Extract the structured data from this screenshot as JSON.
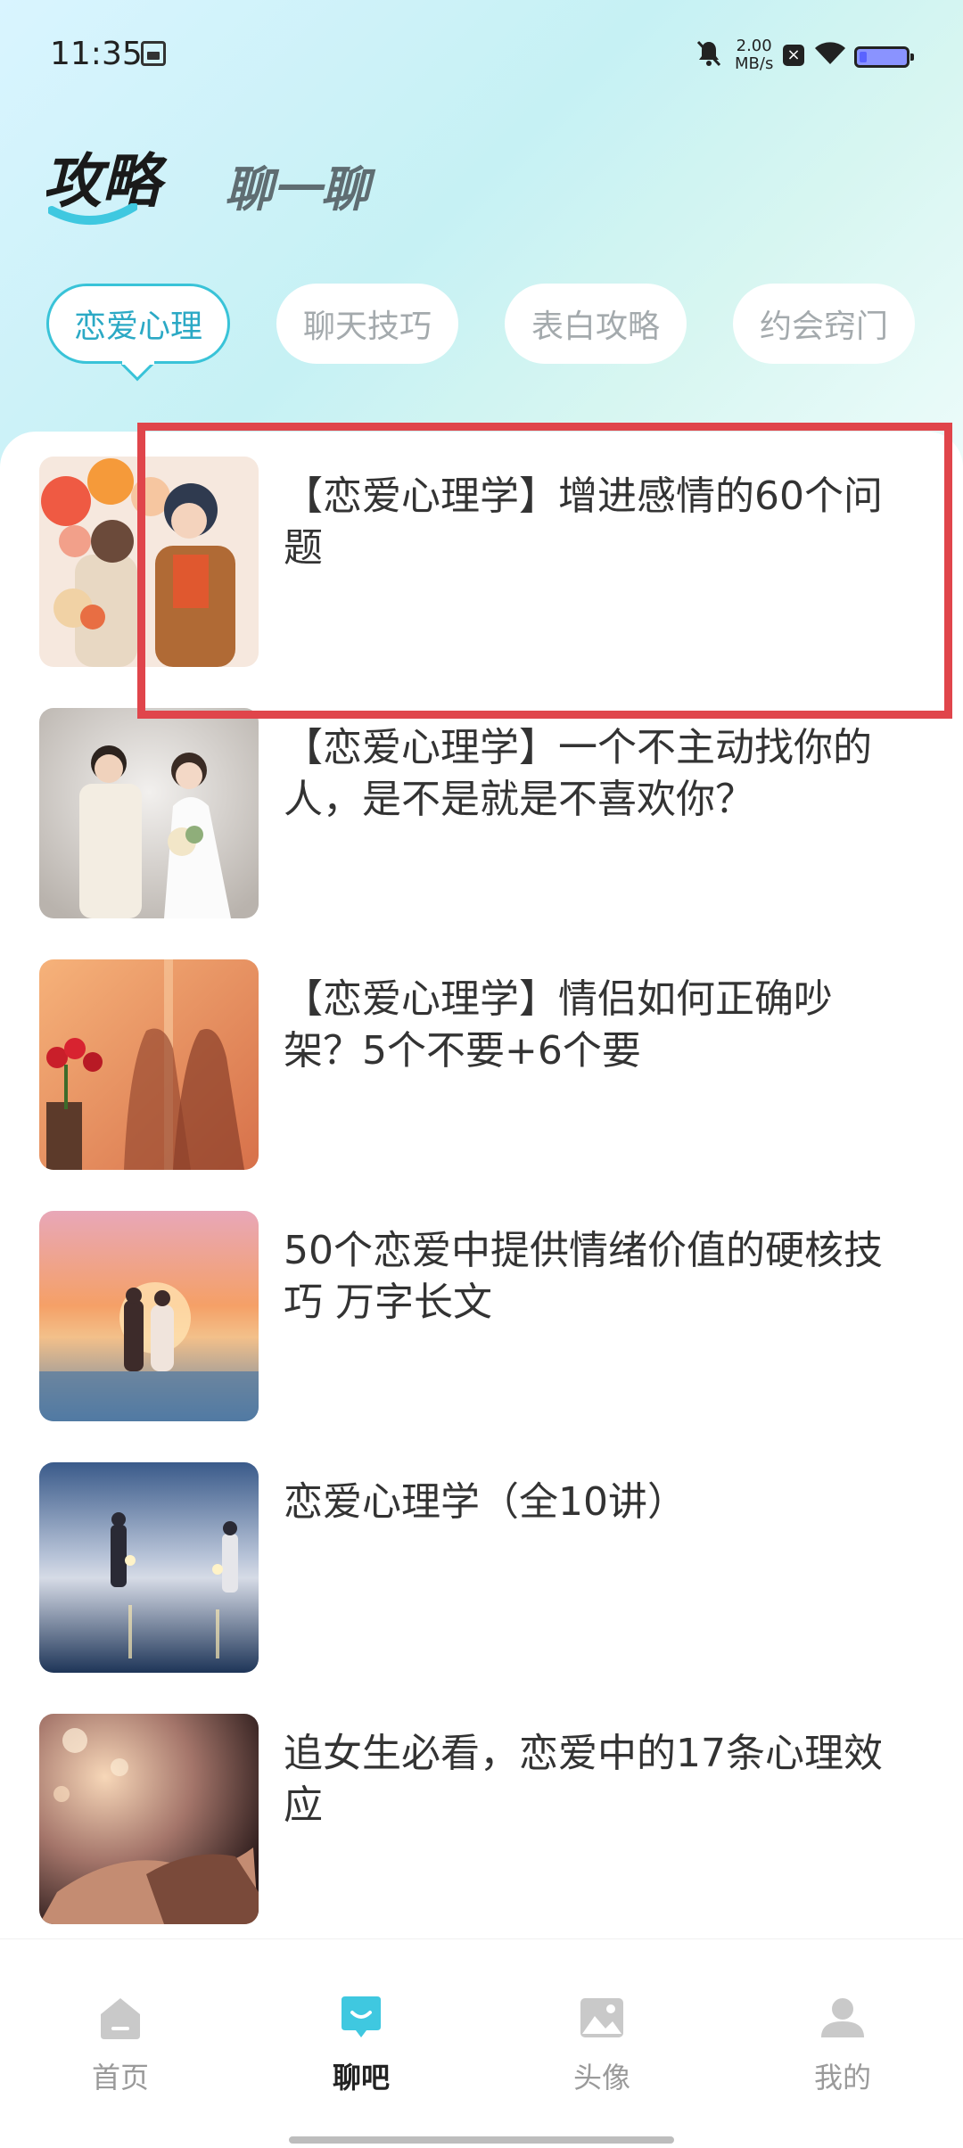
{
  "status_bar": {
    "time": "11:35",
    "speed_value": "2.00",
    "speed_unit": "MB/s"
  },
  "header": {
    "tabs": [
      {
        "label": "攻略",
        "active": true
      },
      {
        "label": "聊一聊",
        "active": false
      }
    ]
  },
  "categories": [
    {
      "label": "恋爱心理",
      "active": true
    },
    {
      "label": "聊天技巧",
      "active": false
    },
    {
      "label": "表白攻略",
      "active": false
    },
    {
      "label": "约会窍门",
      "active": false
    }
  ],
  "articles": [
    {
      "title": "【恋爱心理学】增进感情的60个问题",
      "thumb": "couple-with-balloons"
    },
    {
      "title": "【恋爱心理学】一个不主动找你的人，是不是就是不喜欢你？",
      "thumb": "wedding-couple"
    },
    {
      "title": "【恋爱心理学】情侣如何正确吵架？5个不要+6个要",
      "thumb": "shadow-couple-roses"
    },
    {
      "title": "50个恋爱中提供情绪价值的硬核技巧 万字长文",
      "thumb": "beach-sunset-couple"
    },
    {
      "title": "恋爱心理学（全10讲）",
      "thumb": "beach-sparkler-couple"
    },
    {
      "title": "追女生必看，恋爱中的17条心理效应",
      "thumb": "holding-hands"
    }
  ],
  "bottom_nav": [
    {
      "label": "首页",
      "icon": "home-icon",
      "active": false
    },
    {
      "label": "聊吧",
      "icon": "chat-icon",
      "active": true
    },
    {
      "label": "头像",
      "icon": "image-icon",
      "active": false
    },
    {
      "label": "我的",
      "icon": "profile-icon",
      "active": false
    }
  ],
  "colors": {
    "accent": "#39c3d8",
    "highlight": "#e0454b"
  }
}
